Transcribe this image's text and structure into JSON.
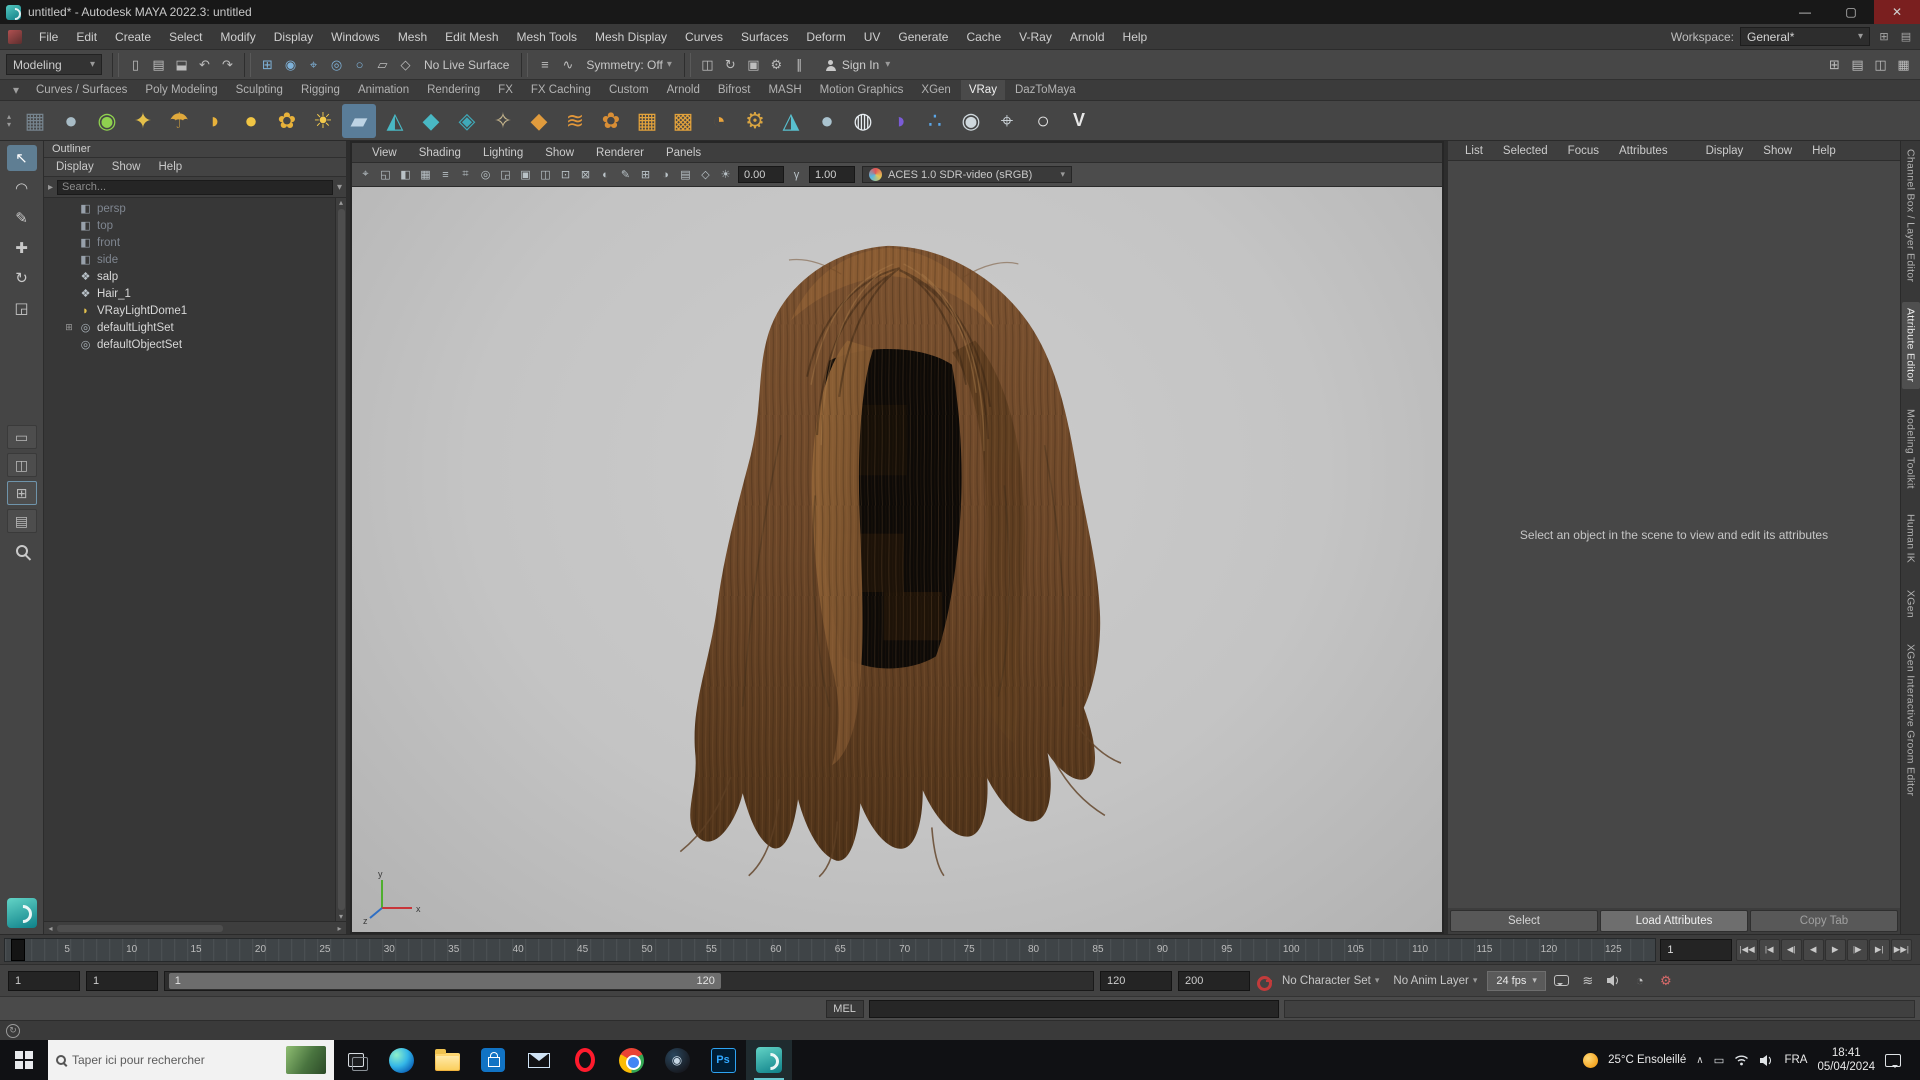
{
  "colors": {
    "accent_blue": "#5285a6",
    "maya_teal": "#149a9e",
    "viewport_bg": "#c6c6c6",
    "hair_base": "#6b4628",
    "hair_dark": "#140d07",
    "hair_light": "#9a6a3a",
    "autokey_red": "#c23b3b"
  },
  "ui": {
    "caret_down": "▾",
    "caret_up": "▴",
    "caret_left": "◂",
    "caret_right": "▸"
  },
  "window": {
    "title": "untitled* - Autodesk MAYA 2022.3: untitled",
    "minimize": "—",
    "maximize": "▢",
    "close": "✕"
  },
  "menu_bar": {
    "items": [
      "File",
      "Edit",
      "Create",
      "Select",
      "Modify",
      "Display",
      "Windows",
      "Mesh",
      "Edit Mesh",
      "Mesh Tools",
      "Mesh Display",
      "Curves",
      "Surfaces",
      "Deform",
      "UV",
      "Generate",
      "Cache",
      "V-Ray",
      "Arnold",
      "Help"
    ],
    "workspace_label": "Workspace:",
    "workspace_value": "General*"
  },
  "status_line": {
    "mode": "Modeling",
    "file_icons": [
      "▯",
      "▤",
      "⬓"
    ],
    "undo": "↶",
    "redo": "↷",
    "snap_icons": [
      "⊞",
      "◉",
      "⌖",
      "◎",
      "○"
    ],
    "sel_icons": [
      "▱",
      "◇"
    ],
    "no_live_surface": "No Live Surface",
    "hist_icons": [
      "≡",
      "∿"
    ],
    "symmetry": "Symmetry: Off",
    "render_icons": [
      "◫",
      "↻",
      "▣",
      "⚙"
    ],
    "pause": "∥",
    "sign_in": "Sign In",
    "right_icons": [
      "⊞",
      "▤",
      "◫",
      "▦"
    ]
  },
  "shelf": {
    "tabs": [
      "Curves / Surfaces",
      "Poly Modeling",
      "Sculpting",
      "Rigging",
      "Animation",
      "Rendering",
      "FX",
      "FX Caching",
      "Custom",
      "Arnold",
      "Bifrost",
      "MASH",
      "Motion Graphics",
      "XGen",
      "VRay",
      "DazToMaya"
    ],
    "tools": [
      {
        "g": "▦",
        "s": "color:#76848e"
      },
      {
        "g": "●",
        "s": "color:#a8bcc6"
      },
      {
        "g": "◉",
        "s": "color:#8fd14f"
      },
      {
        "g": "✦",
        "s": "color:#e5c04a"
      },
      {
        "g": "☂",
        "s": "color:#e0a93c"
      },
      {
        "g": "◗",
        "s": "color:#e8b23a"
      },
      {
        "g": "●",
        "s": "color:#f0c544"
      },
      {
        "g": "✿",
        "s": "color:#e8b23a"
      },
      {
        "g": "☀",
        "s": "color:#f2c94c"
      },
      {
        "g": "▰",
        "s": "color:#bdd3e4"
      },
      {
        "g": "◭",
        "s": "color:#49b8c4"
      },
      {
        "g": "◆",
        "s": "color:#49b8c4"
      },
      {
        "g": "◈",
        "s": "color:#3fa9b8"
      },
      {
        "g": "✧",
        "s": "color:#c8b78e"
      },
      {
        "g": "◆",
        "s": "color:#e09b3d"
      },
      {
        "g": "≋",
        "s": "color:#e2973a"
      },
      {
        "g": "✿",
        "s": "color:#d98e35"
      },
      {
        "g": "▦",
        "s": "color:#e2a23c"
      },
      {
        "g": "▩",
        "s": "color:#e2a23c"
      },
      {
        "g": "◔",
        "s": "color:#e8a33c"
      },
      {
        "g": "⚙",
        "s": "color:#d9a441"
      },
      {
        "g": "◮",
        "s": "color:#58c0cf"
      },
      {
        "g": "●",
        "s": "color:#aac3cf"
      },
      {
        "g": "◍",
        "s": "color:#e8eef2"
      },
      {
        "g": "◑",
        "s": "color:#7a5bd6"
      },
      {
        "g": "∴",
        "s": "color:#5aa6e8"
      },
      {
        "g": "◉",
        "s": "color:#cfd8dd"
      },
      {
        "g": "⌖",
        "s": "color:#c7ced3"
      },
      {
        "g": "○",
        "s": "color:#e8e8e8"
      },
      {
        "g": "V",
        "s": "color:#e8e8e8;font-weight:bold;font-size:18px"
      }
    ]
  },
  "toolbox": {
    "tools": [
      {
        "g": "↖"
      },
      {
        "g": "◠"
      },
      {
        "g": "✎"
      },
      {
        "g": "✚"
      },
      {
        "g": "↻"
      },
      {
        "g": "◲"
      }
    ],
    "layouts": [
      "▭",
      "◫",
      "⊞",
      "▤"
    ]
  },
  "outliner": {
    "title": "Outliner",
    "menus": [
      "Display",
      "Show",
      "Help"
    ],
    "search_placeholder": "Search...",
    "items": [
      {
        "expander": "",
        "icon": "◧",
        "label": "persp",
        "istyle": "color:#98a1ab",
        "lstyle": "color:#7f8690"
      },
      {
        "expander": "",
        "icon": "◧",
        "label": "top",
        "istyle": "color:#98a1ab",
        "lstyle": "color:#7f8690"
      },
      {
        "expander": "",
        "icon": "◧",
        "label": "front",
        "istyle": "color:#98a1ab",
        "lstyle": "color:#7f8690"
      },
      {
        "expander": "",
        "icon": "◧",
        "label": "side",
        "istyle": "color:#98a1ab",
        "lstyle": "color:#7f8690"
      },
      {
        "expander": "",
        "icon": "❖",
        "label": "salp",
        "istyle": "color:#b9c2c9",
        "lstyle": "color:#d8d8d8"
      },
      {
        "expander": "",
        "icon": "❖",
        "label": "Hair_1",
        "istyle": "color:#b9c2c9",
        "lstyle": "color:#d8d8d8"
      },
      {
        "expander": "",
        "icon": "◗",
        "label": "VRayLightDome1",
        "istyle": "color:#e3c14e",
        "lstyle": "color:#d8d8d8"
      },
      {
        "expander": "⊞",
        "icon": "◎",
        "label": "defaultLightSet",
        "istyle": "color:#aab3ba",
        "lstyle": "color:#d8d8d8"
      },
      {
        "expander": "",
        "icon": "◎",
        "label": "defaultObjectSet",
        "istyle": "color:#aab3ba",
        "lstyle": "color:#d8d8d8"
      }
    ]
  },
  "viewport": {
    "menus": [
      "View",
      "Shading",
      "Lighting",
      "Show",
      "Renderer",
      "Panels"
    ],
    "toolbar_icons": [
      "⌖",
      "◱",
      "◧",
      "▦",
      "≡",
      "⌗",
      "◎",
      "◲",
      "▣",
      "◫",
      "⊡",
      "⊠",
      "◐",
      "✎",
      "⊞",
      "◑",
      "▤",
      "◇"
    ],
    "exposure_icon": "☀",
    "exposure": "0.00",
    "gamma_icon": "γ",
    "gamma": "1.00",
    "colorspace": "ACES 1.0 SDR-video (sRGB)"
  },
  "attribute_editor": {
    "menus": [
      "List",
      "Selected",
      "Focus",
      "Attributes",
      "Display",
      "Show",
      "Help"
    ],
    "message": "Select an object in the scene to view and edit its attributes",
    "buttons": [
      "Select",
      "Load Attributes",
      "Copy Tab"
    ]
  },
  "side_tabs": [
    "Channel Box / Layer Editor",
    "Attribute Editor",
    "Modeling Toolkit",
    "Human IK",
    "XGen",
    "XGen Interactive Groom Editor"
  ],
  "time_slider": {
    "ticks": [
      "5",
      "10",
      "15",
      "20",
      "25",
      "30",
      "35",
      "40",
      "45",
      "50",
      "55",
      "60",
      "65",
      "70",
      "75",
      "80",
      "85",
      "90",
      "95",
      "100",
      "105",
      "110",
      "115",
      "120",
      "125"
    ],
    "current_frame": "1",
    "playback": [
      "|◀◀",
      "|◀",
      "◀|",
      "◀",
      "▶",
      "|▶",
      "▶|",
      "▶▶|"
    ]
  },
  "range_slider": {
    "anim_start": "1",
    "play_start": "1",
    "bar_start": "1",
    "bar_end": "120",
    "play_end": "120",
    "anim_end": "200"
  },
  "playback_options": {
    "character_set": "No Character Set",
    "anim_layer": "No Anim Layer",
    "fps": "24 fps"
  },
  "command_line": {
    "mel": "MEL"
  },
  "help_line": {
    "icon": "↻"
  },
  "taskbar": {
    "search_placeholder": "Taper ici pour rechercher",
    "apps": [
      {
        "name": "microsoft-edge"
      },
      {
        "name": "file-explorer"
      },
      {
        "name": "microsoft-store"
      },
      {
        "name": "mail"
      },
      {
        "name": "opera"
      },
      {
        "name": "chrome"
      },
      {
        "name": "steam"
      },
      {
        "name": "adobe-photoshop",
        "label": "Ps"
      },
      {
        "name": "autodesk-maya",
        "active": true
      }
    ],
    "tray": {
      "weather_temp": "25°C",
      "weather_desc": "Ensoleillé",
      "chevron": "∧",
      "lang": "FRA",
      "time": "18:41",
      "date": "05/04/2024"
    }
  }
}
